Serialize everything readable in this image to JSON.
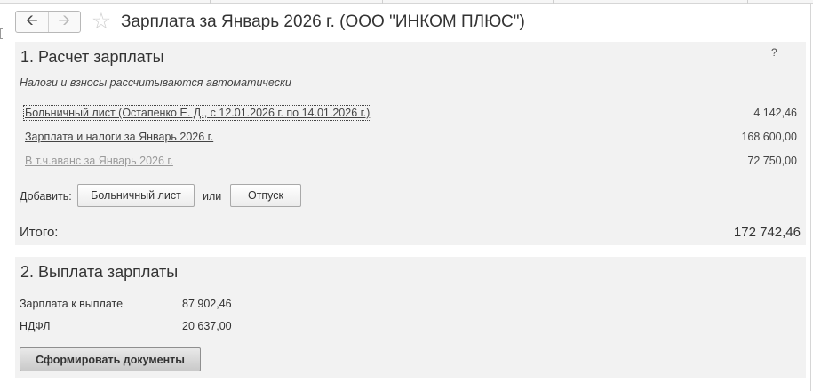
{
  "header": {
    "back_icon": "arrow-left-icon",
    "forward_icon": "arrow-right-icon",
    "favorite_icon": "star-icon",
    "title": "Зарплата за Январь 2026 г. (ООО \"ИНКОМ ПЛЮС\")"
  },
  "calc": {
    "title": "1. Расчет зарплаты",
    "help": "?",
    "note": "Налоги и взносы рассчитываются автоматически",
    "rows": [
      {
        "label": "Больничный лист (Остапенко Е. Д., с 12.01.2026 г. по 14.01.2026 г.)",
        "amount": "4 142,46"
      },
      {
        "label": "Зарплата и налоги за Январь 2026 г.",
        "amount": "168 600,00"
      },
      {
        "label": "В т.ч.аванс за Январь 2026 г.",
        "amount": "72 750,00"
      }
    ],
    "add_label": "Добавить:",
    "sick_leave_button": "Больничный лист",
    "or_label": "или",
    "vacation_button": "Отпуск",
    "total_label": "Итого:",
    "total_value": "172 742,46"
  },
  "payment": {
    "title": "2. Выплата зарплаты",
    "rows": [
      {
        "label": "Зарплата к выплате",
        "value": "87 902,46"
      },
      {
        "label": "НДФЛ",
        "value": "20 637,00"
      }
    ],
    "generate_button": "Сформировать документы"
  }
}
